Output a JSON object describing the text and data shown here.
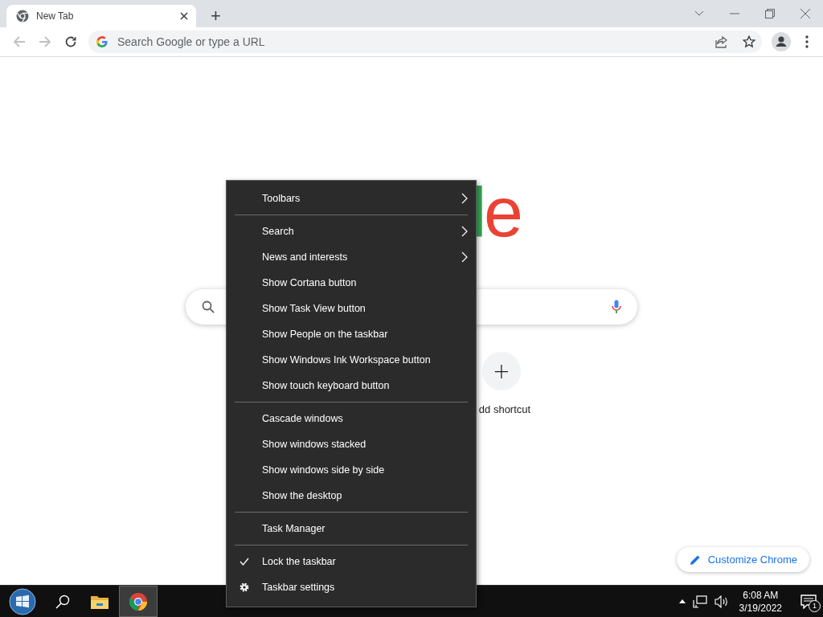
{
  "browser": {
    "tabs": [
      {
        "title": "New Tab",
        "selected": true
      }
    ],
    "new_tab_symbol": "+",
    "toolbar": {
      "back_disabled": true,
      "forward_disabled": true,
      "omnibox": {
        "placeholder": "Search Google or type a URL"
      }
    }
  },
  "new_tab_page": {
    "logo_letters": [
      {
        "text": "l",
        "color": "#34a853"
      },
      {
        "text": "e",
        "color": "#ea4335"
      }
    ],
    "shortcut": {
      "symbol": "+",
      "label": "dd shortcut"
    },
    "customize_button": "Customize Chrome"
  },
  "menu": {
    "groups": [
      {
        "items": [
          {
            "label": "Toolbars",
            "kind": "submenu",
            "checked": false
          }
        ]
      },
      {
        "items": [
          {
            "label": "Search",
            "kind": "submenu",
            "checked": false
          },
          {
            "label": "News and interests",
            "kind": "submenu",
            "checked": false
          },
          {
            "label": "Show Cortana button",
            "kind": "toggle",
            "checked": false
          },
          {
            "label": "Show Task View button",
            "kind": "toggle",
            "checked": false
          },
          {
            "label": "Show People on the taskbar",
            "kind": "toggle",
            "checked": false
          },
          {
            "label": "Show Windows Ink Workspace button",
            "kind": "toggle",
            "checked": false
          },
          {
            "label": "Show touch keyboard button",
            "kind": "toggle",
            "checked": false
          }
        ]
      },
      {
        "items": [
          {
            "label": "Cascade windows",
            "kind": "command",
            "checked": false
          },
          {
            "label": "Show windows stacked",
            "kind": "command",
            "checked": false
          },
          {
            "label": "Show windows side by side",
            "kind": "command",
            "checked": false
          },
          {
            "label": "Show the desktop",
            "kind": "command",
            "checked": false
          }
        ]
      },
      {
        "items": [
          {
            "label": "Task Manager",
            "kind": "command",
            "checked": false
          }
        ]
      },
      {
        "items": [
          {
            "label": "Lock the taskbar",
            "kind": "toggle",
            "checked": true
          },
          {
            "label": "Taskbar settings",
            "kind": "settings",
            "checked": false
          }
        ]
      }
    ]
  },
  "taskbar": {
    "apps": [
      {
        "kind": "explorer",
        "selected": false
      },
      {
        "kind": "chrome",
        "selected": true
      }
    ],
    "clock": {
      "time": "6:08 AM",
      "date": "3/19/2022"
    },
    "notifications_count": "1"
  }
}
